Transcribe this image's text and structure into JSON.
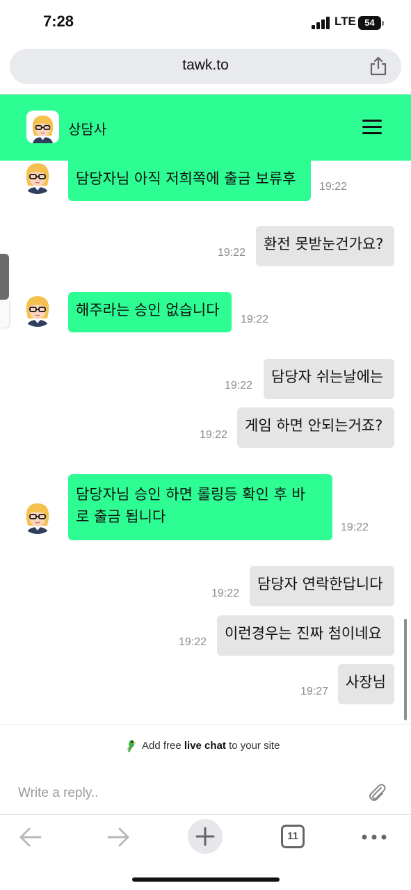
{
  "status_bar": {
    "time": "7:28",
    "network": "LTE",
    "battery": "54"
  },
  "address_bar": {
    "url": "tawk.to",
    "share_icon": "share-icon"
  },
  "chat_header": {
    "agent_name": "상담사",
    "avatar_icon": "agent-avatar",
    "menu_icon": "hamburger-menu-icon",
    "background": "#2dfd92"
  },
  "messages": [
    {
      "sender": "agent",
      "text": "담당자님 아직 저희쪽에 출금 보류후",
      "time": "19:22"
    },
    {
      "sender": "visitor",
      "text": "환전 못받눈건가요?",
      "time": "19:22"
    },
    {
      "sender": "agent",
      "text": "해주라는 승인 없습니다",
      "time": "19:22"
    },
    {
      "sender": "visitor",
      "text": "담당자 쉬는날에는",
      "time": "19:22"
    },
    {
      "sender": "visitor",
      "text": "게임 하면 안되는거죠?",
      "time": "19:22"
    },
    {
      "sender": "agent",
      "text": "담당자님 승인 하면 롤링등 확인 후 바\n로 출금 됩니다",
      "time": "19:22"
    },
    {
      "sender": "visitor",
      "text": "담당자 연락한답니다",
      "time": "19:22"
    },
    {
      "sender": "visitor",
      "text": "이런경우는 진짜 첨이네요",
      "time": "19:22"
    },
    {
      "sender": "visitor",
      "text": "사장님",
      "time": "19:27"
    }
  ],
  "promo": {
    "prefix": "Add free ",
    "bold": "live chat",
    "suffix": " to your site",
    "icon": "tawk-parrot-icon"
  },
  "reply": {
    "placeholder": "Write a reply..",
    "attach_icon": "paperclip-icon"
  },
  "browser_toolbar": {
    "back_icon": "back-arrow-icon",
    "forward_icon": "forward-arrow-icon",
    "new_tab_icon": "plus-icon",
    "tab_count": "11",
    "more_icon": "more-dots-icon"
  },
  "colors": {
    "agent_bubble": "#2dfd92",
    "visitor_bubble": "#e5e5e5",
    "timestamp": "#8c8c8c"
  }
}
